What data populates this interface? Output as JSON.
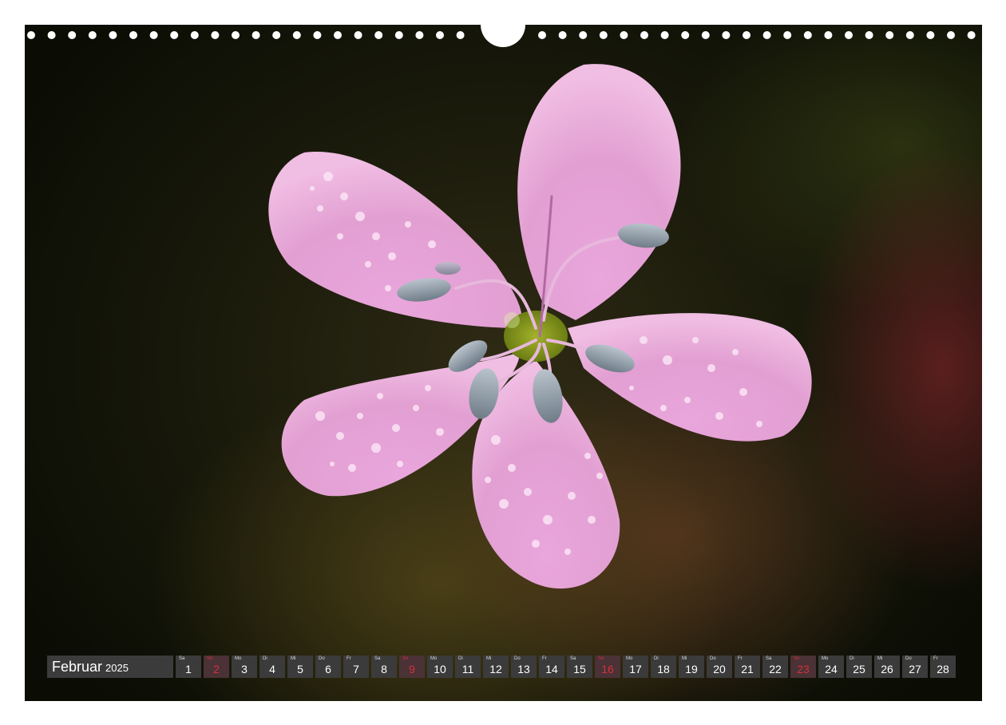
{
  "calendar": {
    "month": "Februar",
    "year": "2025",
    "days": [
      {
        "wd": "Sa",
        "num": "1",
        "sunday": false
      },
      {
        "wd": "So",
        "num": "2",
        "sunday": true
      },
      {
        "wd": "Mo",
        "num": "3",
        "sunday": false
      },
      {
        "wd": "Di",
        "num": "4",
        "sunday": false
      },
      {
        "wd": "Mi",
        "num": "5",
        "sunday": false
      },
      {
        "wd": "Do",
        "num": "6",
        "sunday": false
      },
      {
        "wd": "Fr",
        "num": "7",
        "sunday": false
      },
      {
        "wd": "Sa",
        "num": "8",
        "sunday": false
      },
      {
        "wd": "So",
        "num": "9",
        "sunday": true
      },
      {
        "wd": "Mo",
        "num": "10",
        "sunday": false
      },
      {
        "wd": "Di",
        "num": "11",
        "sunday": false
      },
      {
        "wd": "Mi",
        "num": "12",
        "sunday": false
      },
      {
        "wd": "Do",
        "num": "13",
        "sunday": false
      },
      {
        "wd": "Fr",
        "num": "14",
        "sunday": false
      },
      {
        "wd": "Sa",
        "num": "15",
        "sunday": false
      },
      {
        "wd": "So",
        "num": "16",
        "sunday": true
      },
      {
        "wd": "Mo",
        "num": "17",
        "sunday": false
      },
      {
        "wd": "Di",
        "num": "18",
        "sunday": false
      },
      {
        "wd": "Mi",
        "num": "19",
        "sunday": false
      },
      {
        "wd": "Do",
        "num": "20",
        "sunday": false
      },
      {
        "wd": "Fr",
        "num": "21",
        "sunday": false
      },
      {
        "wd": "Sa",
        "num": "22",
        "sunday": false
      },
      {
        "wd": "So",
        "num": "23",
        "sunday": true
      },
      {
        "wd": "Mo",
        "num": "24",
        "sunday": false
      },
      {
        "wd": "Di",
        "num": "25",
        "sunday": false
      },
      {
        "wd": "Mi",
        "num": "26",
        "sunday": false
      },
      {
        "wd": "Do",
        "num": "27",
        "sunday": false
      },
      {
        "wd": "Fr",
        "num": "28",
        "sunday": false
      }
    ]
  },
  "colors": {
    "cell_background": "#3b3b3b",
    "sunday_text": "#d6303c",
    "text": "#ffffff"
  }
}
